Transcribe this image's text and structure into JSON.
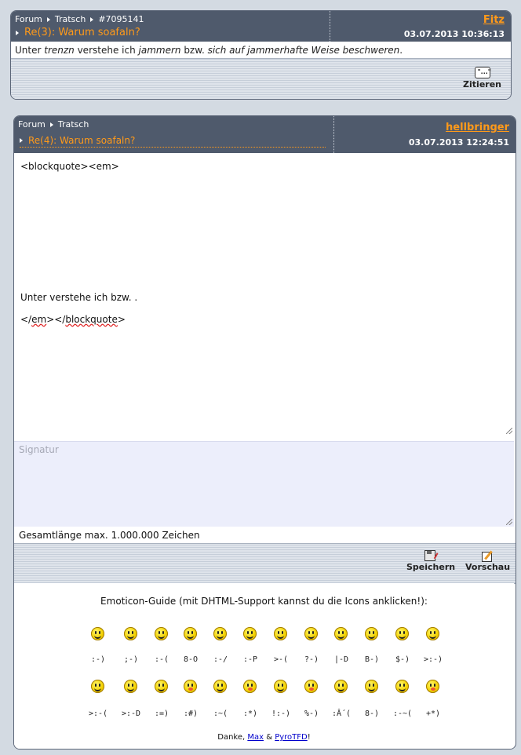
{
  "post1": {
    "breadcrumb": [
      "Forum",
      "Tratsch",
      "#7095141"
    ],
    "subject": "Re(3): Warum soafaln?",
    "author": "Fitz",
    "date": "03.07.2013 10:36:13",
    "body": {
      "p1": "Unter ",
      "e1": "trenzn",
      "p2": " verstehe ich ",
      "e2": "jammern",
      "p3": " bzw. ",
      "e3": "sich auf jammerhafte Weise beschweren",
      "p4": "."
    },
    "quote_label": "Zitieren"
  },
  "post2": {
    "breadcrumb": [
      "Forum",
      "Tratsch"
    ],
    "subject": "Re(4): Warum soafaln?",
    "author": "hellbringer",
    "date": "03.07.2013 12:24:51",
    "editor": {
      "line1": "<blockquote><em>",
      "line2": "Unter  verstehe ich  bzw. .",
      "line3a": "</",
      "line3b": "em",
      "line3c": "></",
      "line3d": "blockquote",
      "line3e": ">"
    },
    "signature_placeholder": "Signatur",
    "max_length_note": "Gesamtlänge max. 1.000.000 Zeichen",
    "save_label": "Speichern",
    "preview_label": "Vorschau"
  },
  "emoticons": {
    "title": "Emoticon-Guide (mit DHTML-Support kannst du die Icons anklicken!):",
    "row1": [
      ":-)",
      ";-)",
      ":-(",
      "8-O",
      ":-/",
      ":-P",
      ">-(",
      "?-)",
      "|-D",
      "B-)",
      "$-)",
      ">:-)"
    ],
    "row2": [
      ">:-(",
      ">:-D",
      ":=)",
      ":#)",
      ":~(",
      ":*)",
      "!:-)",
      "%-)",
      ":Â´(",
      "8-)",
      ":-~(",
      "+*)"
    ],
    "credits": {
      "prefix": "Danke, ",
      "max": "Max",
      "amp": " & ",
      "pyro": "PyroTFD",
      "suffix": "!"
    }
  },
  "colors": {
    "header": "#4f5a6c",
    "accent": "#ff9a1a",
    "page": "#d3dae2",
    "signature_bg": "#eceefb"
  }
}
